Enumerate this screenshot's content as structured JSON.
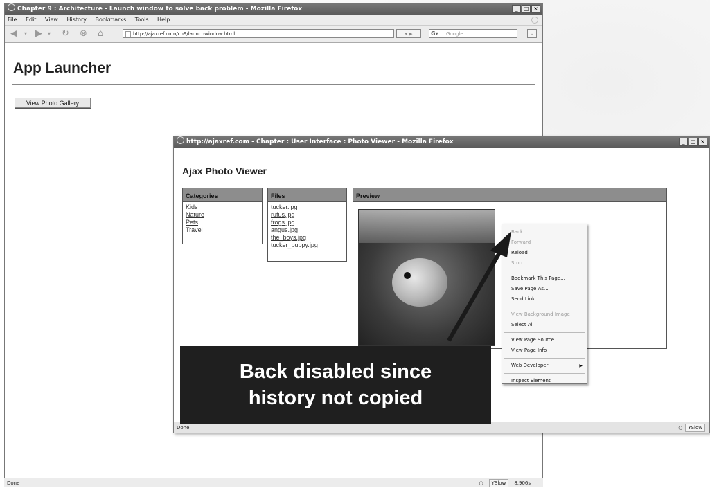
{
  "main_window": {
    "title": "Chapter 9 : Architecture - Launch window to solve back problem - Mozilla Firefox",
    "menu": [
      "File",
      "Edit",
      "View",
      "History",
      "Bookmarks",
      "Tools",
      "Help"
    ],
    "url": "http://ajaxref.com/ch9/launchwindow.html",
    "search_placeholder": "Google",
    "page_title": "App Launcher",
    "button_label": "View Photo Gallery",
    "status": "Done",
    "status_extra": "YSlow",
    "status_time": "8.906s"
  },
  "popup_window": {
    "title": "http://ajaxref.com - Chapter    : User Interface : Photo Viewer - Mozilla Firefox",
    "heading": "Ajax Photo Viewer",
    "categories": {
      "header": "Categories",
      "items": [
        "Kids",
        "Nature",
        "Pets",
        "Travel"
      ]
    },
    "files": {
      "header": "Files",
      "items": [
        "tucker.jpg",
        "rufus.jpg",
        "frogs.jpg",
        "angus.jpg",
        "the_boys.jpg",
        "tucker_puppy.jpg"
      ]
    },
    "preview": {
      "header": "Preview"
    },
    "status": "Done",
    "status_extra": "YSlow"
  },
  "context_menu": {
    "items": [
      {
        "label": "Back",
        "disabled": true
      },
      {
        "label": "Forward",
        "disabled": true
      },
      {
        "label": "Reload",
        "disabled": false
      },
      {
        "label": "Stop",
        "disabled": true
      },
      {
        "separator": true
      },
      {
        "label": "Bookmark This Page...",
        "disabled": false
      },
      {
        "label": "Save Page As...",
        "disabled": false
      },
      {
        "label": "Send Link...",
        "disabled": false
      },
      {
        "separator": true
      },
      {
        "label": "View Background Image",
        "disabled": true
      },
      {
        "label": "Select All",
        "disabled": false
      },
      {
        "separator": true
      },
      {
        "label": "View Page Source",
        "disabled": false
      },
      {
        "label": "View Page Info",
        "disabled": false
      },
      {
        "separator": true
      },
      {
        "label": "Web Developer",
        "disabled": false,
        "submenu": true
      },
      {
        "separator": true
      },
      {
        "label": "Inspect Element",
        "disabled": false
      }
    ]
  },
  "callout": {
    "line1": "Back disabled since",
    "line2": "history not copied"
  },
  "icons": {
    "back": "back-arrow-icon",
    "forward": "forward-arrow-icon",
    "reload": "reload-icon",
    "stop": "stop-icon",
    "home": "home-icon"
  }
}
